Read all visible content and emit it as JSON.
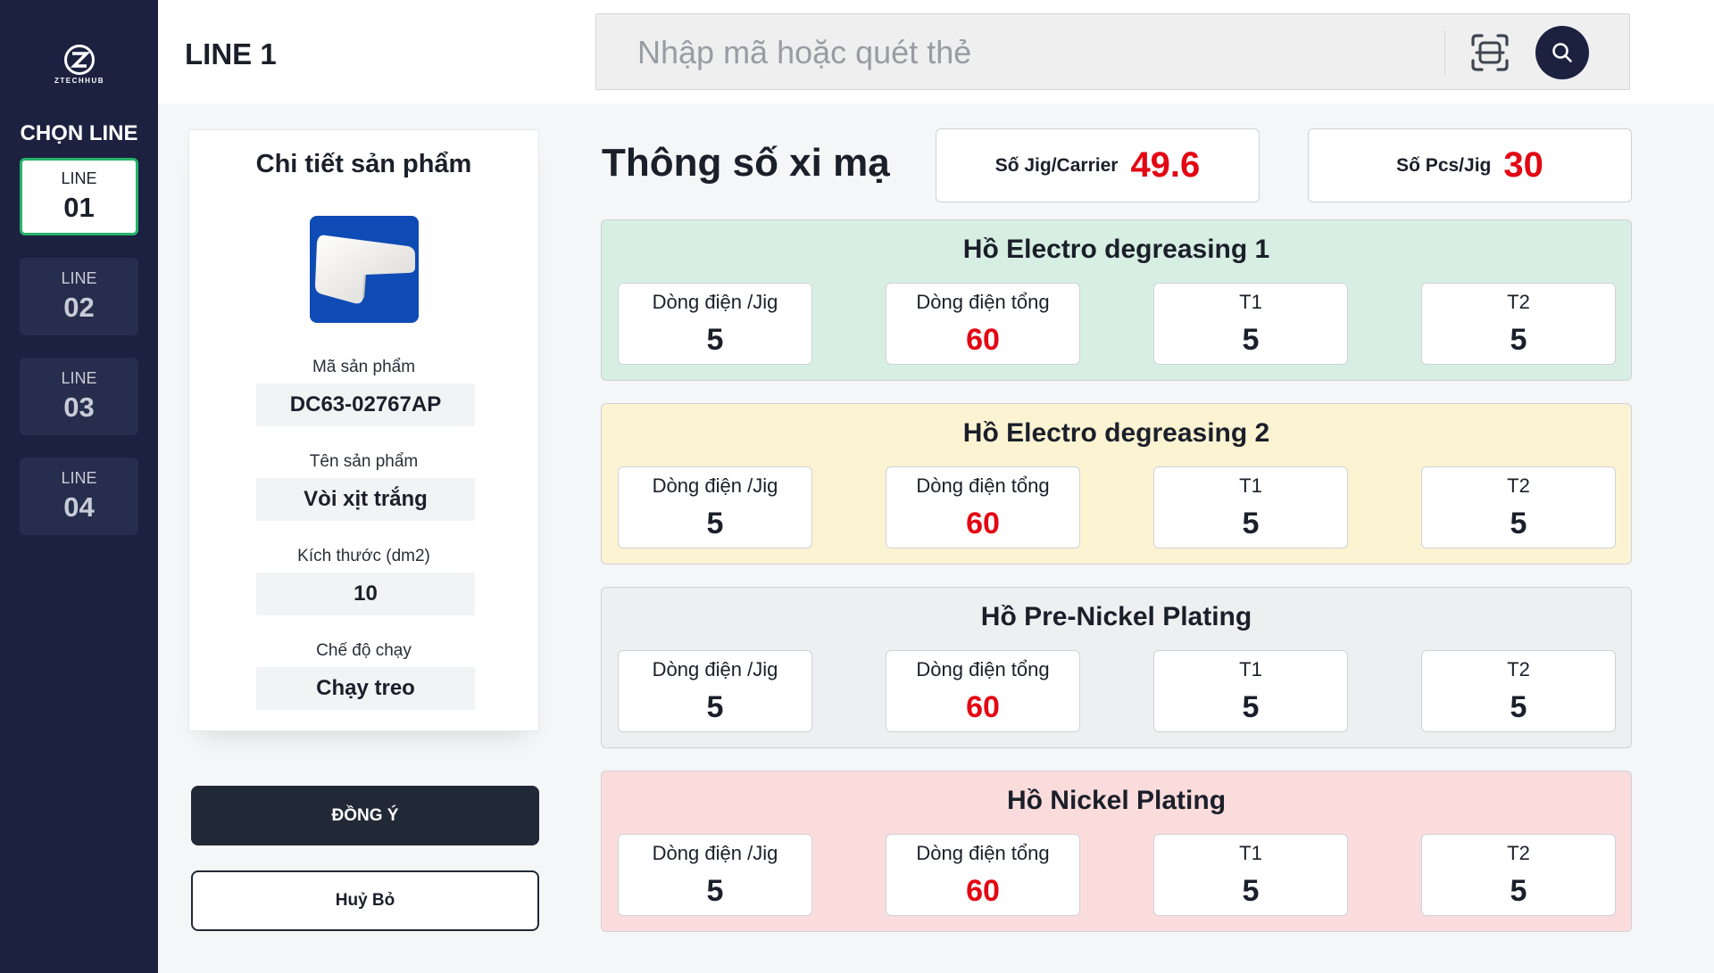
{
  "brand": {
    "logo_text": "ZTECHHUB"
  },
  "sidebar": {
    "heading": "CHỌN LINE",
    "lines": [
      {
        "label": "LINE",
        "number": "01",
        "active": true
      },
      {
        "label": "LINE",
        "number": "02",
        "active": false
      },
      {
        "label": "LINE",
        "number": "03",
        "active": false
      },
      {
        "label": "LINE",
        "number": "04",
        "active": false
      }
    ]
  },
  "header": {
    "title": "LINE 1",
    "search_placeholder": "Nhập mã hoặc quét thẻ",
    "search_value": "",
    "scan_icon": "scan-icon",
    "search_icon": "search-icon"
  },
  "product": {
    "title": "Chi tiết sản phẩm",
    "image_icon": "product-photo",
    "code_label": "Mã sản phẩm",
    "code_value": "DC63-02767AP",
    "name_label": "Tên sản phẩm",
    "name_value": "Vòi xịt trắng",
    "size_label": "Kích thước (dm2)",
    "size_value": "10",
    "mode_label": "Chế độ chạy",
    "mode_value": "Chạy treo"
  },
  "actions": {
    "confirm": "ĐỒNG Ý",
    "cancel": "Huỷ Bỏ"
  },
  "plating": {
    "title": "Thông số xi mạ",
    "jig_label": "Số Jig/Carrier",
    "jig_value": "49.6",
    "pcs_label": "Số Pcs/Jig",
    "pcs_value": "30",
    "value_color": "#e30613"
  },
  "tanks": [
    {
      "name": "Hồ Electro degreasing 1",
      "bg": "#d7efe3",
      "params": [
        {
          "label": "Dòng điện /Jig",
          "value": "5"
        },
        {
          "label": "Dòng điện tổng",
          "value": "60"
        },
        {
          "label": "T1",
          "value": "5"
        },
        {
          "label": "T2",
          "value": "5"
        }
      ]
    },
    {
      "name": "Hồ Electro degreasing 2",
      "bg": "#fcf3d2",
      "params": [
        {
          "label": "Dòng điện /Jig",
          "value": "5"
        },
        {
          "label": "Dòng điện tổng",
          "value": "60"
        },
        {
          "label": "T1",
          "value": "5"
        },
        {
          "label": "T2",
          "value": "5"
        }
      ]
    },
    {
      "name": "Hồ Pre-Nickel Plating",
      "bg": "#eeeff1",
      "params": [
        {
          "label": "Dòng điện /Jig",
          "value": "5"
        },
        {
          "label": "Dòng điện tổng",
          "value": "60"
        },
        {
          "label": "T1",
          "value": "5"
        },
        {
          "label": "T2",
          "value": "5"
        }
      ]
    },
    {
      "name": "Hồ Nickel Plating",
      "bg": "#fbdcdc",
      "params": [
        {
          "label": "Dòng điện /Jig",
          "value": "5"
        },
        {
          "label": "Dòng điện tổng",
          "value": "60"
        },
        {
          "label": "T1",
          "value": "5"
        },
        {
          "label": "T2",
          "value": "5"
        }
      ]
    }
  ]
}
